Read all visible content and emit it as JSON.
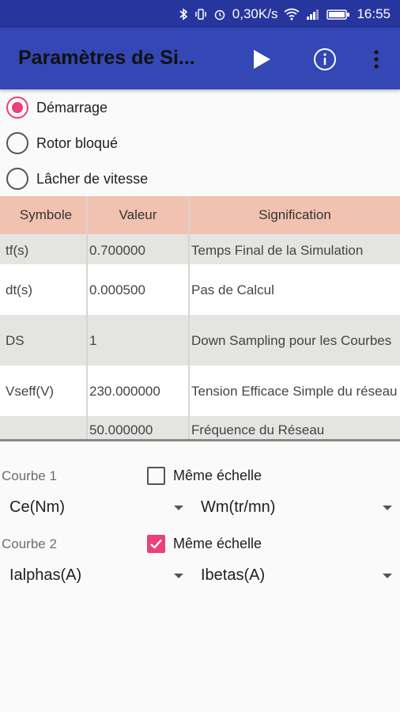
{
  "status_bar": {
    "network_speed": "0,30K/s",
    "time": "16:55",
    "icons": [
      "bluetooth-icon",
      "vibrate-icon",
      "alarm-icon",
      "wifi-icon",
      "signal-icon",
      "battery-icon"
    ]
  },
  "app_bar": {
    "title": "Paramètres de Si...",
    "actions": [
      "play-icon",
      "info-icon",
      "overflow-menu-icon"
    ]
  },
  "modes": [
    {
      "label": "Démarrage",
      "checked": true
    },
    {
      "label": "Rotor bloqué",
      "checked": false
    },
    {
      "label": "Lâcher de vitesse",
      "checked": false
    }
  ],
  "table": {
    "headers": [
      "Symbole",
      "Valeur",
      "Signification"
    ],
    "rows": [
      [
        "tf(s)",
        "0.700000",
        "Temps Final de la Simulation"
      ],
      [
        "dt(s)",
        "0.000500",
        "Pas de Calcul"
      ],
      [
        "DS",
        "1",
        "Down Sampling pour les Courbes"
      ],
      [
        "Vseff(V)",
        "230.000000",
        "Tension Efficace Simple du réseau"
      ],
      [
        "",
        "50.000000",
        "Fréquence du Réseau"
      ]
    ]
  },
  "curves": {
    "curve1": {
      "label": "Courbe 1",
      "same_scale_label": "Même échelle",
      "same_scale_checked": false,
      "left_value": "Ce(Nm)",
      "right_value": "Wm(tr/mn)"
    },
    "curve2": {
      "label": "Courbe 2",
      "same_scale_label": "Même échelle",
      "same_scale_checked": true,
      "left_value": "Ialphas(A)",
      "right_value": "Ibetas(A)"
    }
  },
  "colors": {
    "status_bar": "#27359e",
    "app_bar": "#3447b5",
    "accent": "#ec407a",
    "table_header": "#f2c2b0"
  }
}
